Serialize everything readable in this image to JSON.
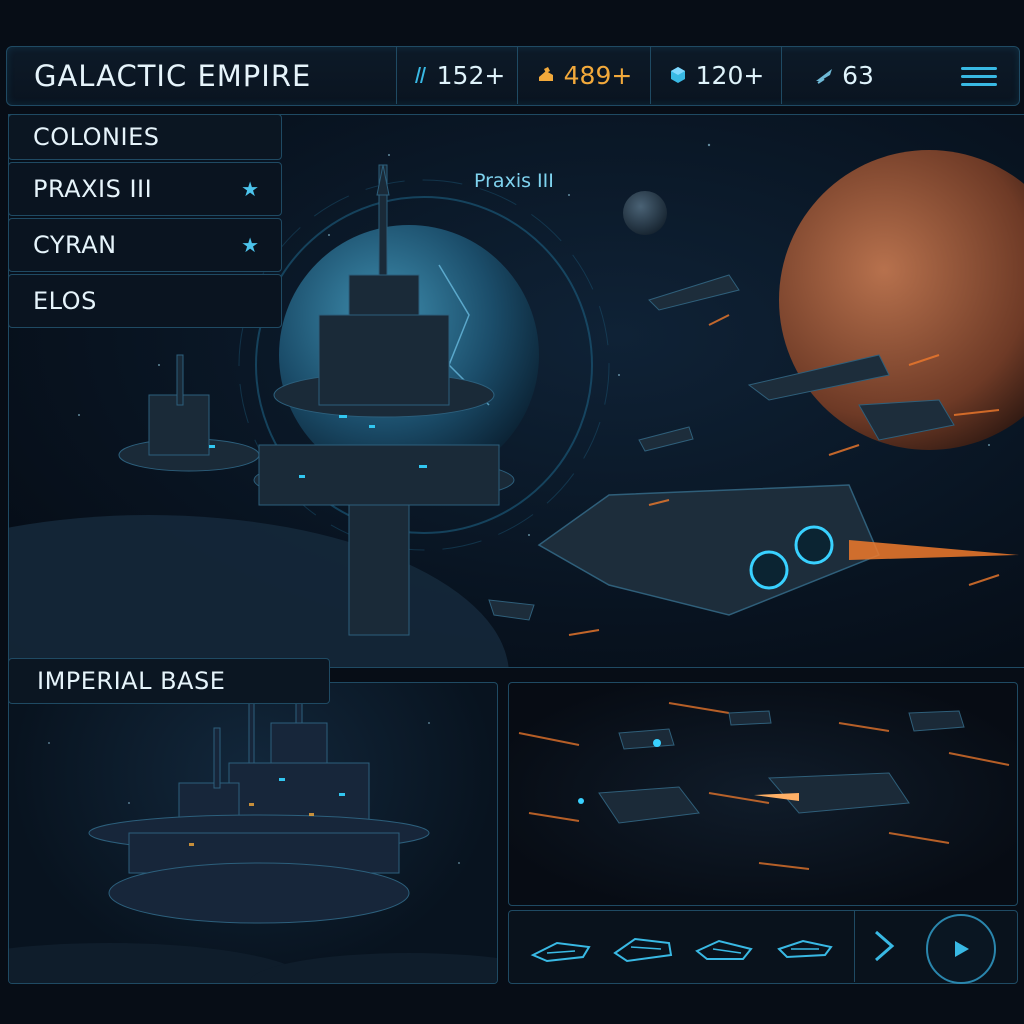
{
  "header": {
    "title": "GALACTIC EMPIRE",
    "resources": [
      {
        "icon": "energy-icon",
        "value": "152+",
        "color": "#dff3fb"
      },
      {
        "icon": "gold-icon",
        "value": "489+",
        "color": "#f2a93b"
      },
      {
        "icon": "crystal-icon",
        "value": "120+",
        "color": "#dff3fb"
      },
      {
        "icon": "fleet-icon",
        "value": "63",
        "color": "#dff3fb"
      }
    ],
    "menu_icon": "menu-icon"
  },
  "colonies": {
    "heading": "COLONIES",
    "items": [
      {
        "label": "PRAXIS III",
        "starred": true
      },
      {
        "label": "CYRAN",
        "starred": true
      },
      {
        "label": "ELOS",
        "starred": false
      }
    ]
  },
  "scene": {
    "planet_label": "Praxis III"
  },
  "base": {
    "heading": "IMPERIAL BASE"
  },
  "shipbar": {
    "ships": [
      "fighter-ship-icon",
      "cruiser-ship-icon",
      "frigate-ship-icon",
      "destroyer-ship-icon"
    ],
    "next_icon": "chevron-right-icon",
    "play_icon": "play-icon"
  },
  "colors": {
    "accent": "#39b9e4",
    "gold": "#f2a93b",
    "border": "#1f4a63",
    "background": "#070d16"
  }
}
